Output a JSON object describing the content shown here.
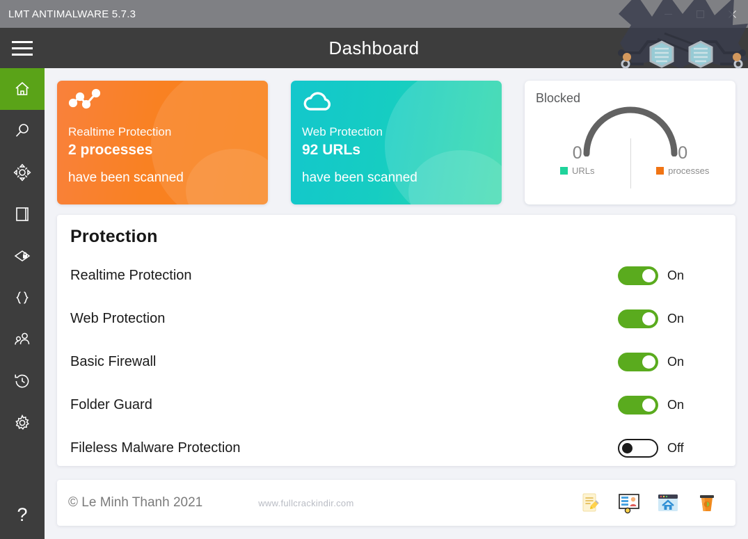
{
  "window": {
    "title": "LMT ANTIMALWARE 5.7.3",
    "controls": [
      {
        "name": "minimize-button",
        "glyph": "minimize"
      },
      {
        "name": "maximize-button",
        "glyph": "maximize"
      },
      {
        "name": "close-button",
        "glyph": "close"
      }
    ]
  },
  "header": {
    "title": "Dashboard",
    "menu_icon": "hamburger-icon"
  },
  "sidebar": {
    "items": [
      {
        "icon": "home-icon",
        "name": "sidebar-item-home",
        "active": true
      },
      {
        "icon": "search-icon",
        "name": "sidebar-item-scan",
        "active": false
      },
      {
        "icon": "target-icon",
        "name": "sidebar-item-realtime",
        "active": false
      },
      {
        "icon": "window-icon",
        "name": "sidebar-item-quarantine",
        "active": false
      },
      {
        "icon": "folder-lock-icon",
        "name": "sidebar-item-folder-guard",
        "active": false
      },
      {
        "icon": "braces-icon",
        "name": "sidebar-item-scripts",
        "active": false
      },
      {
        "icon": "users-icon",
        "name": "sidebar-item-users",
        "active": false
      },
      {
        "icon": "history-icon",
        "name": "sidebar-item-history",
        "active": false
      },
      {
        "icon": "gear-icon",
        "name": "sidebar-item-settings",
        "active": false
      }
    ],
    "help": {
      "label": "?",
      "name": "sidebar-item-help"
    }
  },
  "cards": {
    "realtime": {
      "icon": "network-graph-icon",
      "label": "Realtime Protection",
      "value": "2 processes",
      "sub": "have been scanned",
      "color": "#f98122"
    },
    "web": {
      "icon": "cloud-icon",
      "label": "Web Protection",
      "value": "92 URLs",
      "sub": "have been scanned",
      "color": "#16cdc2"
    },
    "blocked": {
      "title": "Blocked",
      "stats": [
        {
          "value": "0",
          "label": "URLs",
          "color": "#1fd39b"
        },
        {
          "value": "0",
          "label": "processes",
          "color": "#f07414"
        }
      ],
      "gauge_color": "#626262"
    }
  },
  "protection": {
    "title": "Protection",
    "rows": [
      {
        "name": "Realtime Protection",
        "state": "On",
        "on": true
      },
      {
        "name": "Web Protection",
        "state": "On",
        "on": true
      },
      {
        "name": "Basic Firewall",
        "state": "On",
        "on": true
      },
      {
        "name": "Folder Guard",
        "state": "On",
        "on": true
      },
      {
        "name": "Fileless Malware Protection",
        "state": "Off",
        "on": false
      }
    ]
  },
  "footer": {
    "copyright": "© Le Minh Thanh 2021",
    "watermark": "www.fullcrackindir.com",
    "icons": [
      {
        "name": "notes-icon"
      },
      {
        "name": "presentation-icon"
      },
      {
        "name": "browser-home-icon"
      },
      {
        "name": "coffee-cup-icon"
      }
    ]
  }
}
